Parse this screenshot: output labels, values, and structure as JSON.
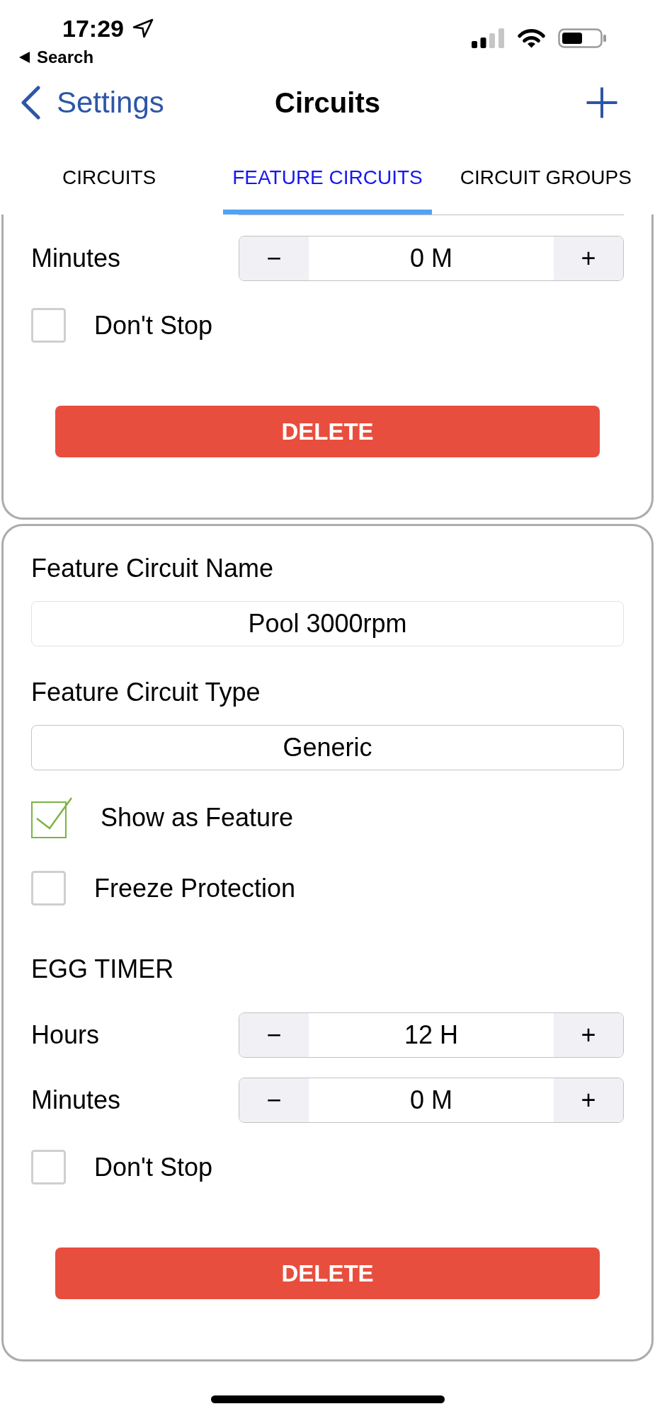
{
  "status_bar": {
    "time": "17:29",
    "back_label": "Search"
  },
  "nav_bar": {
    "back_label": "Settings",
    "title": "Circuits"
  },
  "tabs": [
    {
      "label": "CIRCUITS",
      "selected": false
    },
    {
      "label": "FEATURE CIRCUITS",
      "selected": true
    },
    {
      "label": "CIRCUIT GROUPS",
      "selected": false
    }
  ],
  "cards": [
    {
      "clipped": true,
      "items": [
        {
          "kind": "stepper",
          "label": "Minutes",
          "value": "0 M",
          "decrement": "−",
          "increment": "+"
        },
        {
          "kind": "checkbox",
          "label": "Don't Stop",
          "checked": false
        },
        {
          "kind": "button",
          "label": "DELETE"
        }
      ]
    },
    {
      "clipped": false,
      "items": [
        {
          "kind": "text_field",
          "label": "Feature Circuit Name",
          "value": "Pool 3000rpm"
        },
        {
          "kind": "select_field",
          "label": "Feature Circuit Type",
          "value": "Generic"
        },
        {
          "kind": "checkbox",
          "label": "Show as Feature",
          "checked": true
        },
        {
          "kind": "checkbox",
          "label": "Freeze Protection",
          "checked": false
        },
        {
          "kind": "section_heading",
          "label": "EGG TIMER"
        },
        {
          "kind": "stepper",
          "label": "Hours",
          "value": "12 H",
          "decrement": "−",
          "increment": "+"
        },
        {
          "kind": "stepper",
          "label": "Minutes",
          "value": "0 M",
          "decrement": "−",
          "increment": "+"
        },
        {
          "kind": "checkbox",
          "label": "Don't Stop",
          "checked": false
        },
        {
          "kind": "button",
          "label": "DELETE"
        }
      ]
    }
  ]
}
